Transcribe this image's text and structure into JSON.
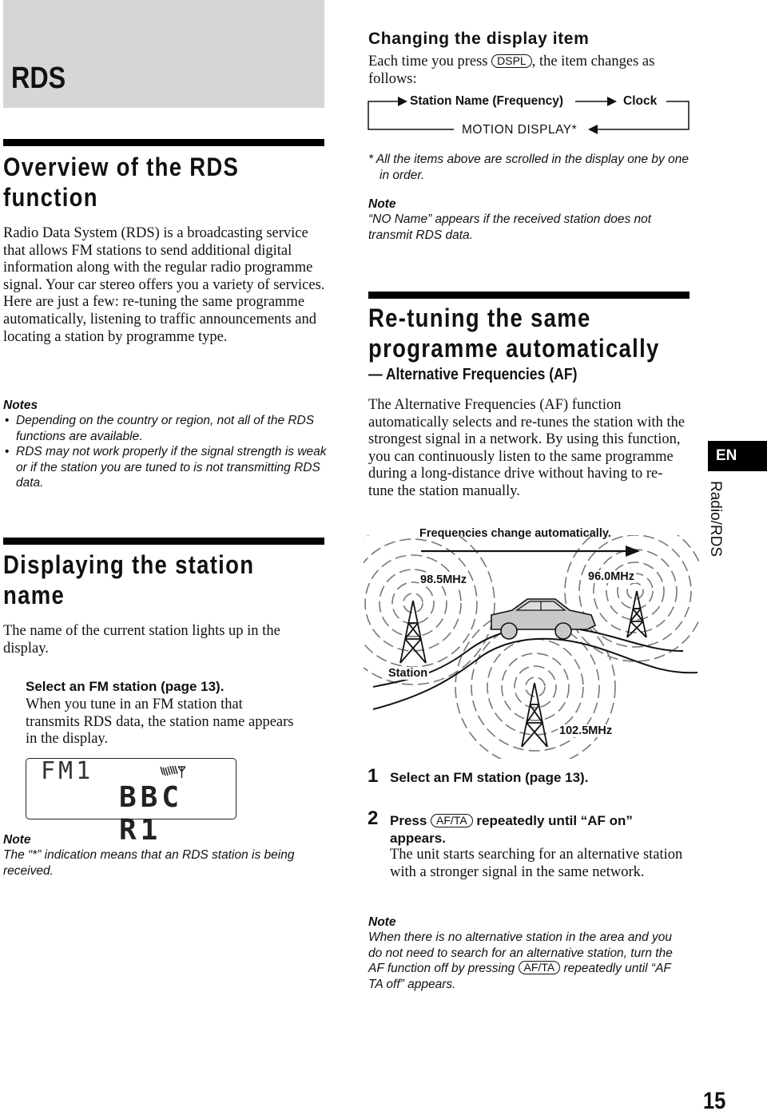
{
  "chapter": {
    "title": "RDS"
  },
  "overview": {
    "heading_lines": [
      "Overview of the RDS",
      "function"
    ],
    "paragraph": "Radio Data System (RDS) is a broadcasting service that allows FM stations to send additional digital information along with the regular radio programme signal. Your car stereo offers you a variety of services. Here are just a few: re-tuning the same programme automatically, listening to traffic announcements and locating a station by programme type.",
    "notes_title": "Notes",
    "notes": [
      "Depending on the country or region, not all of the RDS functions are available.",
      "RDS may not work properly if the signal strength is weak or if the station you are tuned to is not transmitting RDS data."
    ]
  },
  "displaying": {
    "heading_lines": [
      "Displaying the station",
      "name"
    ],
    "paragraph": "The name of the current station lights up in the display.",
    "step_title": "Select an FM station (page 13).",
    "step_text": "When you tune in an FM station that transmits RDS data, the station name appears in the display.",
    "lcd": {
      "band": "FM1",
      "station": "BBC R1",
      "rds_indicator": "signal-antenna-icon"
    },
    "note_title": "Note",
    "note_text": "The “*” indication means that an RDS station is being received."
  },
  "changing": {
    "heading": "Changing the display item",
    "intro_before": "Each time you press ",
    "intro_key": "DSPL",
    "intro_after": ", the item changes as follows:",
    "flow": {
      "item1": "Station Name (Frequency)",
      "item2": "Clock",
      "item3": "MOTION DISPLAY*"
    },
    "footnote": "* All the items above are scrolled in the display one by one in order.",
    "note_title": "Note",
    "note_text": "“NO Name” appears if the received station does not transmit RDS data."
  },
  "retuning": {
    "heading_lines": [
      "Re-tuning the same",
      "programme automatically"
    ],
    "subheading": "— Alternative Frequencies (AF)",
    "paragraph": "The Alternative Frequencies (AF) function automatically selects and re-tunes the station with the strongest signal in a network. By using this function, you can continuously listen to the same programme during a long-distance drive without having to re-tune the station manually.",
    "diagram": {
      "caption": "Frequencies change automatically.",
      "freq_left": "98.5MHz",
      "freq_right": "96.0MHz",
      "freq_bottom": "102.5MHz",
      "station_label": "Station"
    },
    "steps": [
      {
        "num": "1",
        "title": "Select an FM station (page 13)."
      },
      {
        "num": "2",
        "title_before": "Press ",
        "key": "AF/TA",
        "title_after": " repeatedly until “AF on” appears.",
        "text": "The unit starts searching for an alternative station with a stronger signal in the same network."
      }
    ],
    "note_title": "Note",
    "note_text_before": "When there is no alternative station in the area and you do not need to search for an alternative station, turn the AF function off by pressing ",
    "note_key": "AF/TA",
    "note_text_after": " repeatedly until “AF TA off” appears."
  },
  "side_tab": {
    "lang": "EN",
    "section": "Radio/RDS"
  },
  "page_number": "15"
}
